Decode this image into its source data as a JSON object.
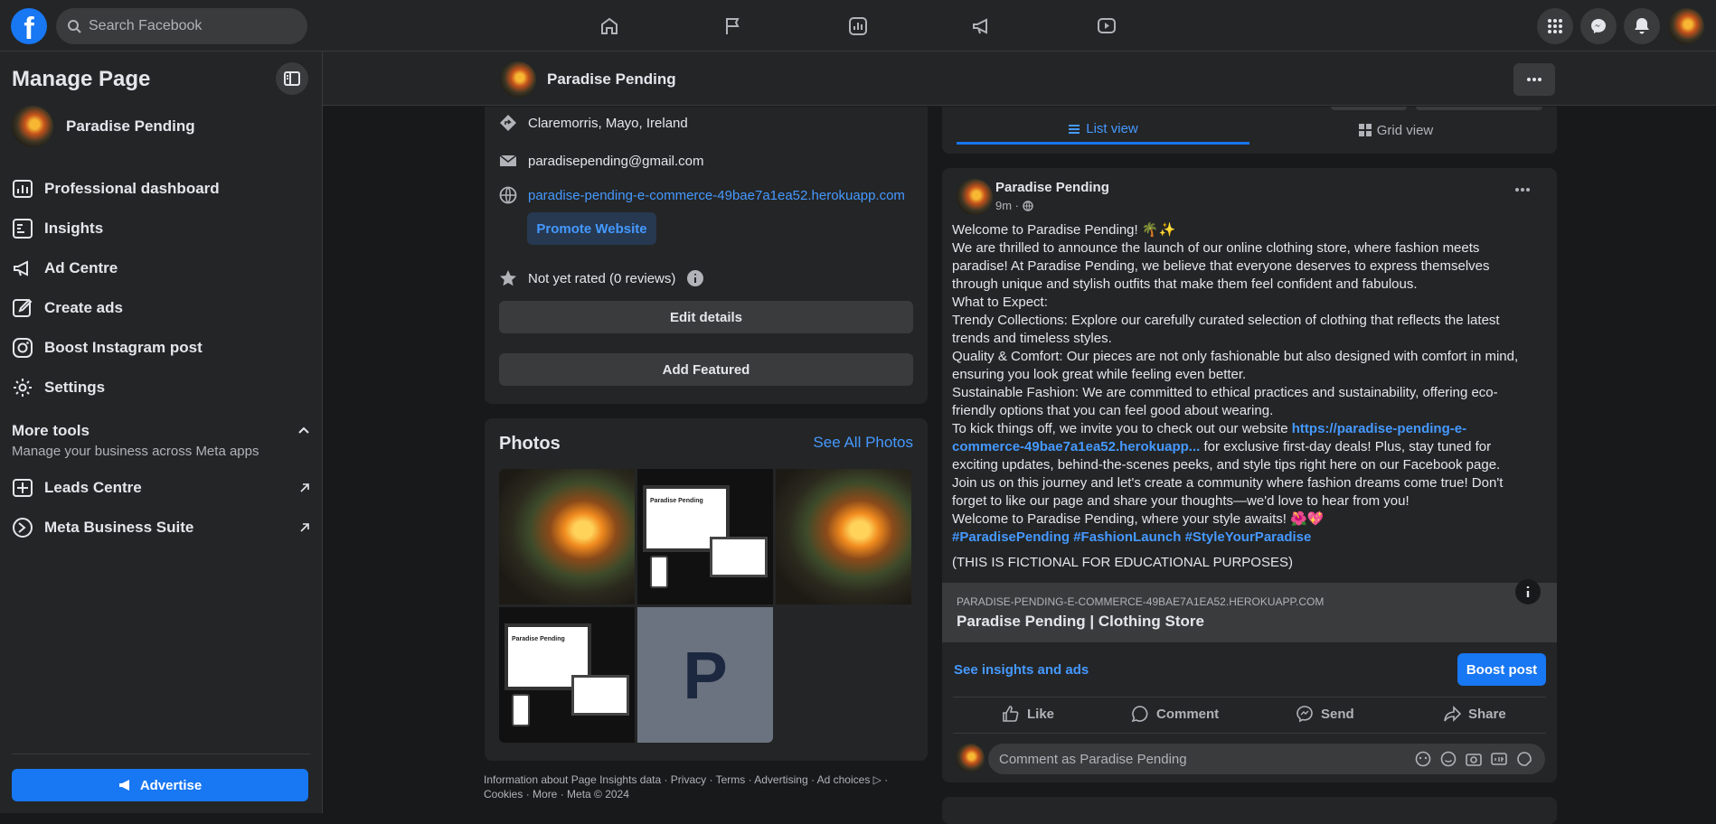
{
  "topbar": {
    "logo": "f",
    "search_placeholder": "Search Facebook",
    "nav_icons": [
      "home-icon",
      "flag-icon",
      "insights-icon",
      "megaphone-icon",
      "video-icon"
    ],
    "right_icons": [
      "menu-grid-icon",
      "messenger-icon",
      "notifications-icon"
    ]
  },
  "sidebar": {
    "title": "Manage Page",
    "page_name": "Paradise Pending",
    "items": [
      {
        "label": "Professional dashboard",
        "icon": "dashboard-icon"
      },
      {
        "label": "Insights",
        "icon": "insights-icon"
      },
      {
        "label": "Ad Centre",
        "icon": "megaphone-icon"
      },
      {
        "label": "Create ads",
        "icon": "pencil-icon"
      },
      {
        "label": "Boost Instagram post",
        "icon": "instagram-icon"
      },
      {
        "label": "Settings",
        "icon": "gear-icon"
      }
    ],
    "more_tools_title": "More tools",
    "more_tools_subtitle": "Manage your business across Meta apps",
    "tools": [
      {
        "label": "Leads Centre",
        "icon": "leads-icon"
      },
      {
        "label": "Meta Business Suite",
        "icon": "meta-business-icon"
      }
    ],
    "advertise_label": "Advertise"
  },
  "page_header": {
    "name": "Paradise Pending"
  },
  "about": {
    "location": "Claremorris, Mayo, Ireland",
    "email": "paradisepending@gmail.com",
    "website": "paradise-pending-e-commerce-49bae7a1ea52.herokuapp.com",
    "promote_label": "Promote Website",
    "rating": "Not yet rated (0 reviews)",
    "edit_details_label": "Edit details",
    "add_featured_label": "Add Featured"
  },
  "photos": {
    "title": "Photos",
    "see_all_label": "See All Photos",
    "placeholder_letter": "P",
    "mockup_title": "Paradise Pending"
  },
  "footer": {
    "text": "Information about Page Insights data · Privacy · Terms · Advertising · Ad choices ▷ · Cookies · More · Meta © 2024"
  },
  "view_tabs": {
    "list_label": "List view",
    "grid_label": "Grid view"
  },
  "post": {
    "author": "Paradise Pending",
    "time": "9m ·",
    "lines": [
      "Welcome to Paradise Pending! 🌴✨",
      "We are thrilled to announce the launch of our online clothing store, where fashion meets paradise! At Paradise Pending, we believe that everyone deserves to express themselves through unique and stylish outfits that make them feel confident and fabulous.",
      "What to Expect:",
      "Trendy Collections: Explore our carefully curated selection of clothing that reflects the latest trends and timeless styles.",
      "Quality & Comfort: Our pieces are not only fashionable but also designed with comfort in mind, ensuring you look great while feeling even better.",
      "Sustainable Fashion: We are committed to ethical practices and sustainability, offering eco-friendly options that you can feel good about wearing."
    ],
    "website_intro": "To kick things off, we invite you to check out our website ",
    "website_link": "https://paradise-pending-e-commerce-49bae7a1ea52.herokuapp...",
    "website_outro": " for exclusive first-day deals! Plus, stay tuned for exciting updates, behind-the-scenes peeks, and style tips right here on our Facebook page.",
    "lines2": [
      "Join us on this journey and let's create a community where fashion dreams come true! Don't forget to like our page and share your thoughts—we'd love to hear from you!",
      "Welcome to Paradise Pending, where your style awaits! 🌺💖"
    ],
    "hashtags": "#ParadisePending #FashionLaunch #StyleYourParadise",
    "disclaimer": "(THIS IS FICTIONAL FOR EDUCATIONAL PURPOSES)",
    "link_domain": "PARADISE-PENDING-E-COMMERCE-49BAE7A1EA52.HEROKUAPP.COM",
    "link_title": "Paradise Pending | Clothing Store",
    "insights_label": "See insights and ads",
    "boost_label": "Boost post",
    "actions": {
      "like": "Like",
      "comment": "Comment",
      "send": "Send",
      "share": "Share"
    },
    "comment_placeholder": "Comment as Paradise Pending"
  }
}
